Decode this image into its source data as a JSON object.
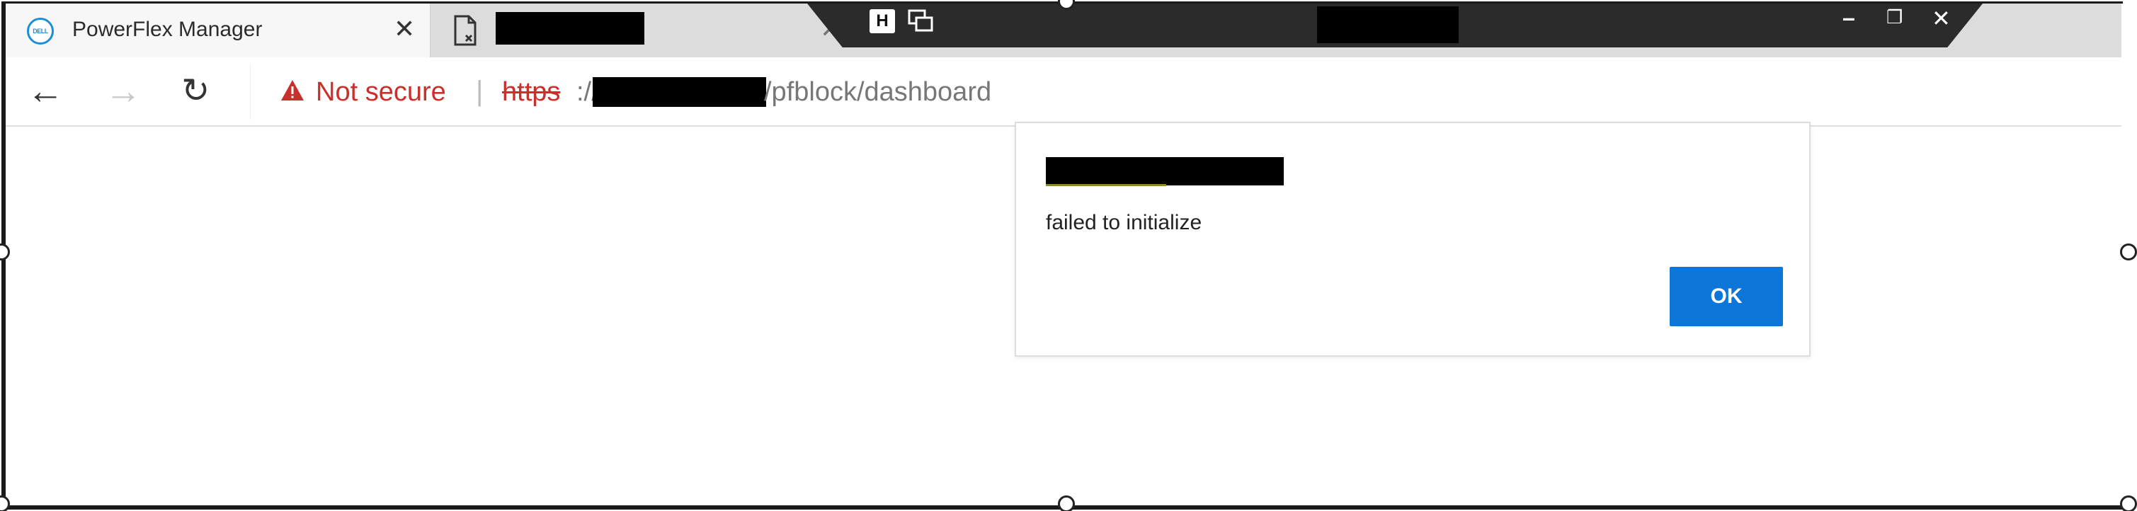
{
  "tabs": [
    {
      "title": "PowerFlex Manager",
      "favicon": "dell-logo-icon",
      "active": true
    },
    {
      "title": "",
      "favicon": "document-error-icon",
      "active": false
    }
  ],
  "nav": {
    "back": "back-arrow-icon",
    "forward": "forward-arrow-icon",
    "reload": "reload-icon"
  },
  "address": {
    "security_text": "Not secure",
    "scheme": "https",
    "scheme_sep": "://",
    "path": "/pfblock/dashboard"
  },
  "dialog": {
    "message": "failed to initialize",
    "ok_label": "OK"
  },
  "colors": {
    "warning_red": "#c9302c",
    "ok_blue": "#0d76d8",
    "rd_bar": "#2b2b2b"
  }
}
